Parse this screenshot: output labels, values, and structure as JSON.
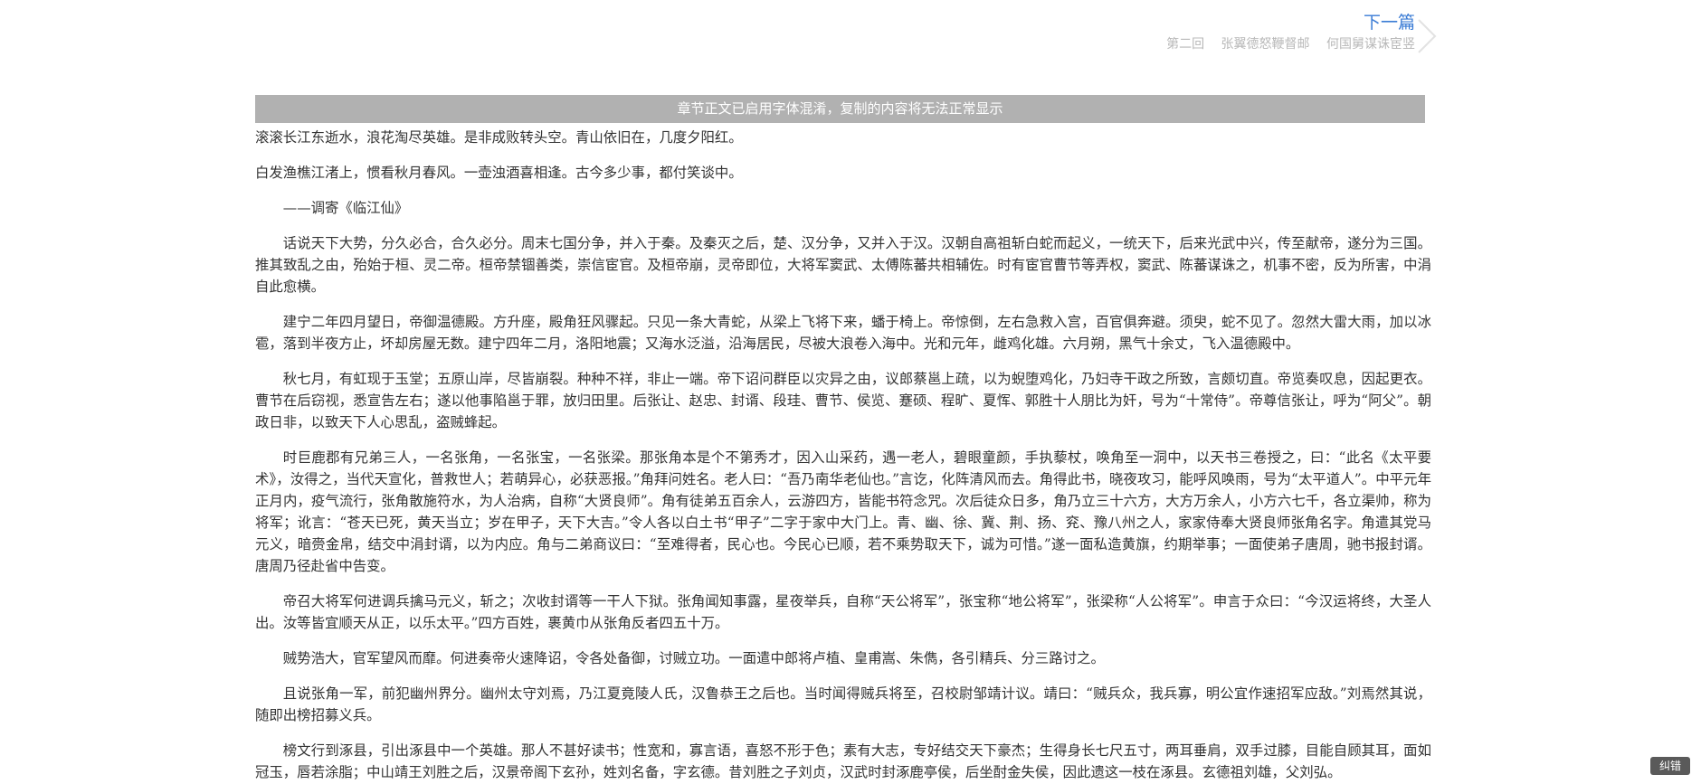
{
  "next_chapter": {
    "title": "下一篇",
    "chapter_no": "第二回",
    "chapter_line1": "张翼德怒鞭督邮",
    "chapter_line2": "何国舅谋诛宦竖"
  },
  "notice": "章节正文已启用字体混淆，复制的内容将无法正常显示",
  "paragraphs": [
    "滚滚长江东逝水，浪花淘尽英雄。是非成败转头空。青山依旧在，几度夕阳红。",
    "白发渔樵江渚上，惯看秋月春风。一壶浊酒喜相逢。古今多少事，都付笑谈中。",
    "——调寄《临江仙》",
    "话说天下大势，分久必合，合久必分。周末七国分争，并入于秦。及秦灭之后，楚、汉分争，又并入于汉。汉朝自高祖斩白蛇而起义，一统天下，后来光武中兴，传至献帝，遂分为三国。推其致乱之由，殆始于桓、灵二帝。桓帝禁锢善类，崇信宦官。及桓帝崩，灵帝即位，大将军窦武、太傅陈蕃共相辅佐。时有宦官曹节等弄权，窦武、陈蕃谋诛之，机事不密，反为所害，中涓自此愈横。",
    "建宁二年四月望日，帝御温德殿。方升座，殿角狂风骤起。只见一条大青蛇，从梁上飞将下来，蟠于椅上。帝惊倒，左右急救入宫，百官俱奔避。须臾，蛇不见了。忽然大雷大雨，加以冰雹，落到半夜方止，坏却房屋无数。建宁四年二月，洛阳地震；又海水泛溢，沿海居民，尽被大浪卷入海中。光和元年，雌鸡化雄。六月朔，黑气十余丈，飞入温德殿中。",
    "秋七月，有虹现于玉堂；五原山岸，尽皆崩裂。种种不祥，非止一端。帝下诏问群臣以灾异之由，议郎蔡邕上疏，以为蜺堕鸡化，乃妇寺干政之所致，言颇切直。帝览奏叹息，因起更衣。曹节在后窃视，悉宣告左右；遂以他事陷邕于罪，放归田里。后张让、赵忠、封谞、段珪、曹节、侯览、蹇硕、程旷、夏恽、郭胜十人朋比为奸，号为“十常侍”。帝尊信张让，呼为“阿父”。朝政日非，以致天下人心思乱，盗贼蜂起。",
    "时巨鹿郡有兄弟三人，一名张角，一名张宝，一名张梁。那张角本是个不第秀才，因入山采药，遇一老人，碧眼童颜，手执藜杖，唤角至一洞中，以天书三卷授之，曰：“此名《太平要术》，汝得之，当代天宣化，普救世人；若萌异心，必获恶报。”角拜问姓名。老人曰：“吾乃南华老仙也。”言讫，化阵清风而去。角得此书，晓夜攻习，能呼风唤雨，号为“太平道人”。中平元年正月内，疫气流行，张角散施符水，为人治病，自称“大贤良师”。角有徒弟五百余人，云游四方，皆能书符念咒。次后徒众日多，角乃立三十六方，大方万余人，小方六七千，各立渠帅，称为将军；讹言：“苍天已死，黄天当立；岁在甲子，天下大吉。”令人各以白土书“甲子”二字于家中大门上。青、幽、徐、冀、荆、扬、兖、豫八州之人，家家侍奉大贤良师张角名字。角遣其党马元义，暗赍金帛，结交中涓封谞，以为内应。角与二弟商议曰：“至难得者，民心也。今民心已顺，若不乘势取天下，诚为可惜。”遂一面私造黄旗，约期举事；一面使弟子唐周，驰书报封谞。唐周乃径赴省中告变。",
    "帝召大将军何进调兵擒马元义，斩之；次收封谞等一干人下狱。张角闻知事露，星夜举兵，自称“天公将军”，张宝称“地公将军”，张梁称“人公将军”。申言于众曰：“今汉运将终，大圣人出。汝等皆宜顺天从正，以乐太平。”四方百姓，裹黄巾从张角反者四五十万。",
    "贼势浩大，官军望风而靡。何进奏帝火速降诏，令各处备御，讨贼立功。一面遣中郎将卢植、皇甫嵩、朱儁，各引精兵、分三路讨之。",
    "且说张角一军，前犯幽州界分。幽州太守刘焉，乃江夏竟陵人氏，汉鲁恭王之后也。当时闻得贼兵将至，召校尉邹靖计议。靖曰：“贼兵众，我兵寡，明公宜作速招军应敌。”刘焉然其说，随即出榜招募义兵。",
    "榜文行到涿县，引出涿县中一个英雄。那人不甚好读书；性宽和，寡言语，喜怒不形于色；素有大志，专好结交天下豪杰；生得身长七尺五寸，两耳垂肩，双手过膝，目能自顾其耳，面如冠玉，唇若涂脂；中山靖王刘胜之后，汉景帝阁下玄孙，姓刘名备，字玄德。昔刘胜之子刘贞，汉武时封涿鹿亭侯，后坐酎金失侯，因此遗这一枝在涿县。玄德祖刘雄，父刘弘。"
  ],
  "report_button": "纠错"
}
